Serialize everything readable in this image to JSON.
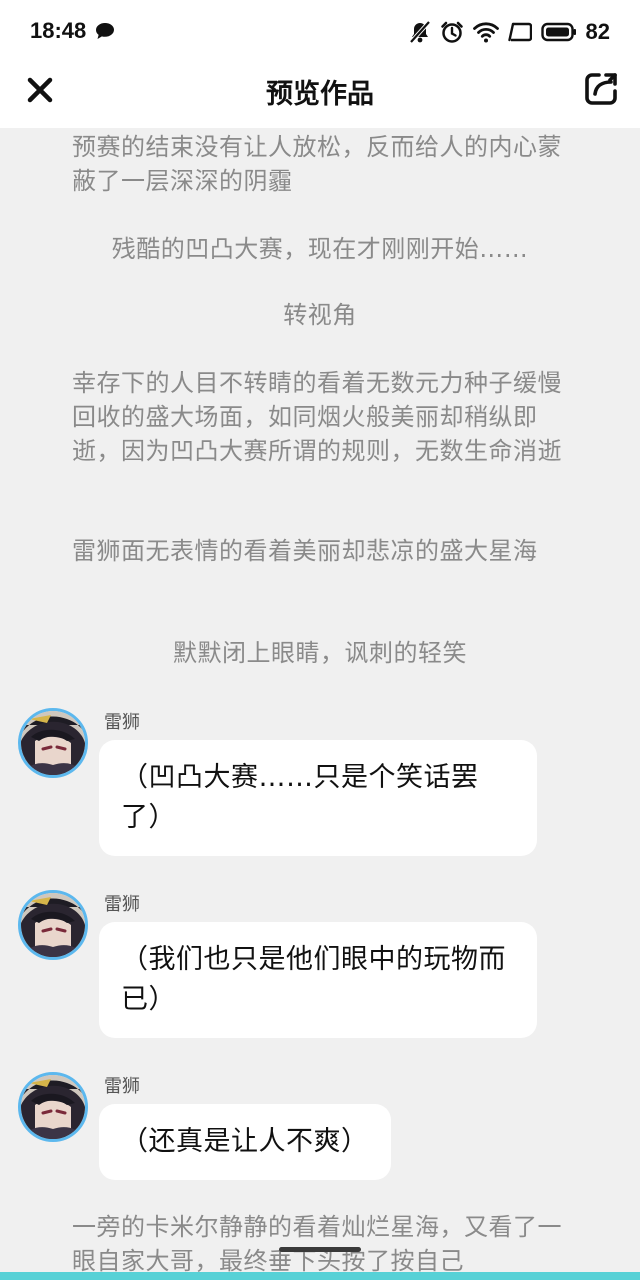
{
  "status_bar": {
    "time": "18:48",
    "battery": "82"
  },
  "title_bar": {
    "title": "预览作品"
  },
  "paragraphs": [
    "预赛的结束没有让人放松，反而给人的内心蒙蔽了一层深深的阴霾",
    "残酷的凹凸大赛，现在才刚刚开始……",
    "转视角",
    "幸存下的人目不转睛的看着无数元力种子缓慢回收的盛大场面，如同烟火般美丽却稍纵即逝，因为凹凸大赛所谓的规则，无数生命消逝",
    "雷狮面无表情的看着美丽却悲凉的盛大星海",
    "默默闭上眼睛，讽刺的轻笑"
  ],
  "messages": [
    {
      "sender": "雷狮",
      "text": "（凹凸大赛……只是个笑话罢了）"
    },
    {
      "sender": "雷狮",
      "text": "（我们也只是他们眼中的玩物而已）"
    },
    {
      "sender": "雷狮",
      "text": "（还真是让人不爽）"
    }
  ],
  "trailing_paragraph": "一旁的卡米尔静静的看着灿烂星海，又看了一眼自家大哥，最终垂下头按了按自己",
  "colors": {
    "background": "#f0f0f0",
    "avatar_ring": "#5cb8ee",
    "bottom_accent": "#57d1d6"
  }
}
